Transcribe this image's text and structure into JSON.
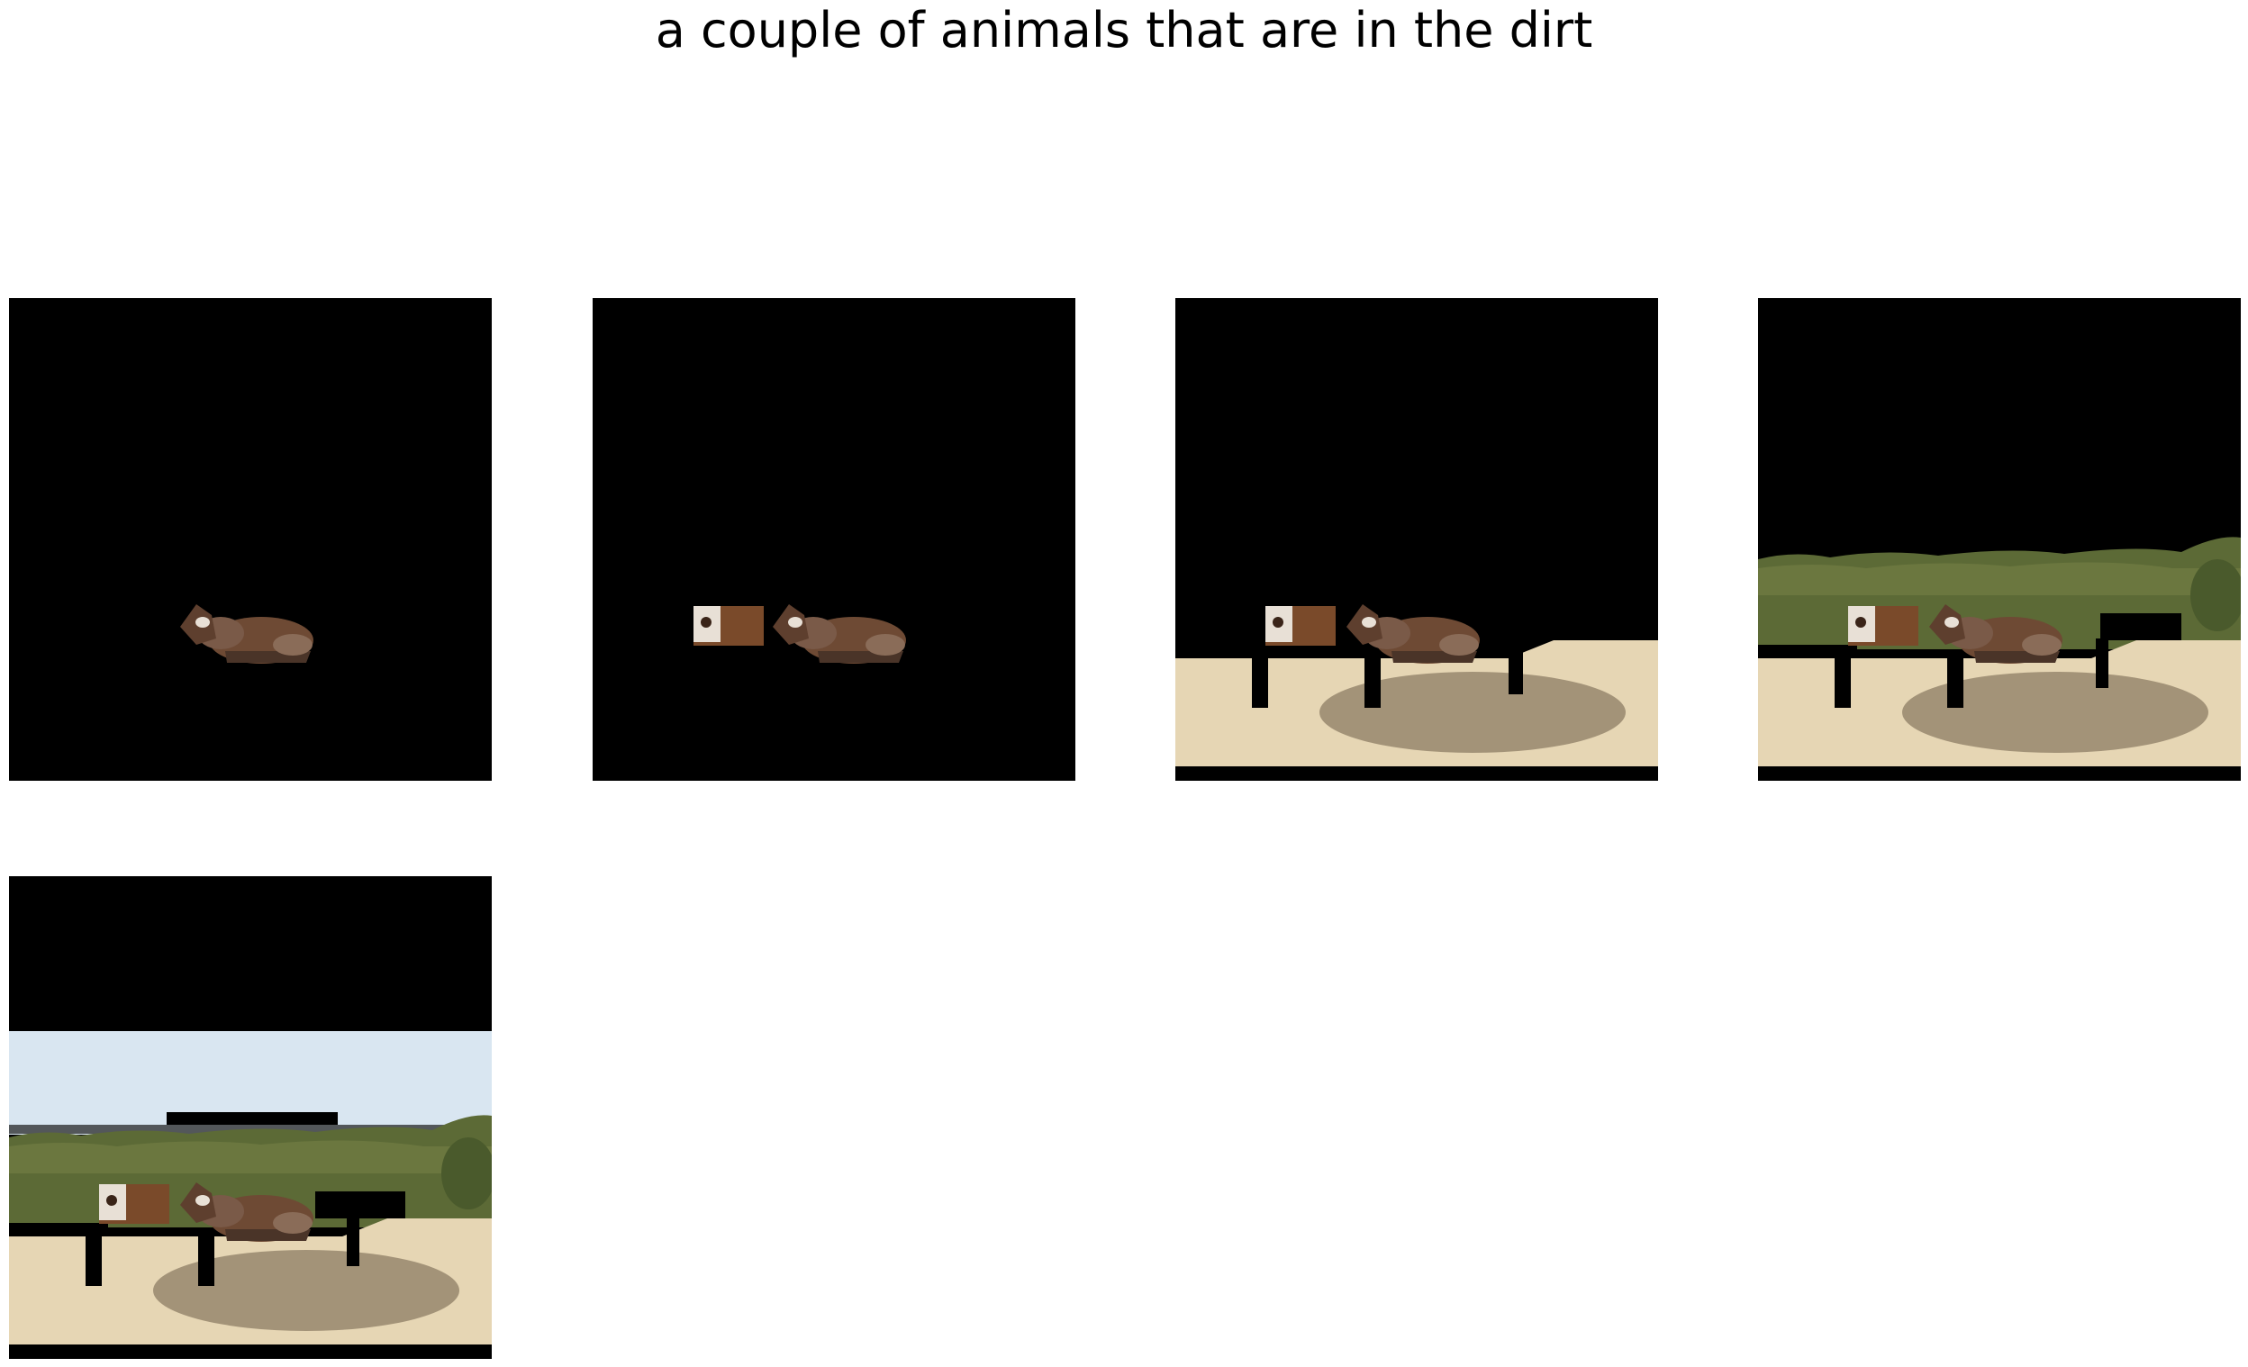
{
  "caption": "a couple of animals that are in the dirt",
  "panels": [
    {
      "index": 1,
      "visible_layers": [
        "cow-right"
      ]
    },
    {
      "index": 2,
      "visible_layers": [
        "cow-left",
        "cow-right"
      ]
    },
    {
      "index": 3,
      "visible_layers": [
        "cow-left",
        "cow-right",
        "sand"
      ]
    },
    {
      "index": 4,
      "visible_layers": [
        "cow-left",
        "cow-right",
        "sand",
        "bushes"
      ]
    },
    {
      "index": 5,
      "visible_layers": [
        "cow-left",
        "cow-right",
        "sand",
        "bushes",
        "sky"
      ]
    }
  ],
  "colors": {
    "masked": "#000000",
    "sand": "#e6d6b4",
    "shadow": "#8c7c64",
    "bush": "#5c6a36",
    "sky": "#d9e6f1",
    "cow_brown": "#6e4a34",
    "cow_white": "#e8e0d6"
  }
}
